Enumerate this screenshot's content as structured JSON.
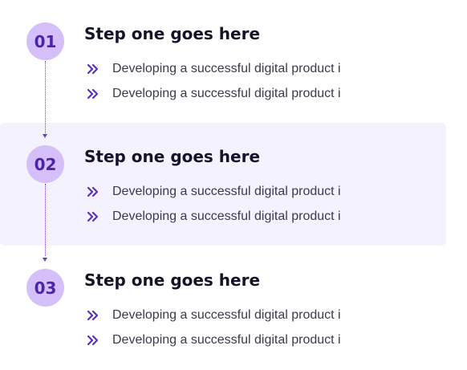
{
  "steps": [
    {
      "number": "01",
      "title": "Step one goes here",
      "bullets": [
        "Developing a successful digital product i",
        "Developing a successful digital product i"
      ]
    },
    {
      "number": "02",
      "title": "Step one goes here",
      "bullets": [
        "Developing a successful digital product i",
        "Developing a successful digital product i"
      ]
    },
    {
      "number": "03",
      "title": "Step one goes here",
      "bullets": [
        "Developing a successful digital product i",
        "Developing a successful digital product i"
      ]
    }
  ],
  "icons": {
    "bullet": "double-chevron-right-icon",
    "connector": "dotted-arrow-down-icon"
  },
  "colors": {
    "badge_bg": "#d4bff9",
    "badge_text": "#4a25a8",
    "highlight_bg": "#f4f2fe",
    "accent": "#5b2fc0",
    "title": "#141428",
    "body_text": "#3a3a4c"
  }
}
